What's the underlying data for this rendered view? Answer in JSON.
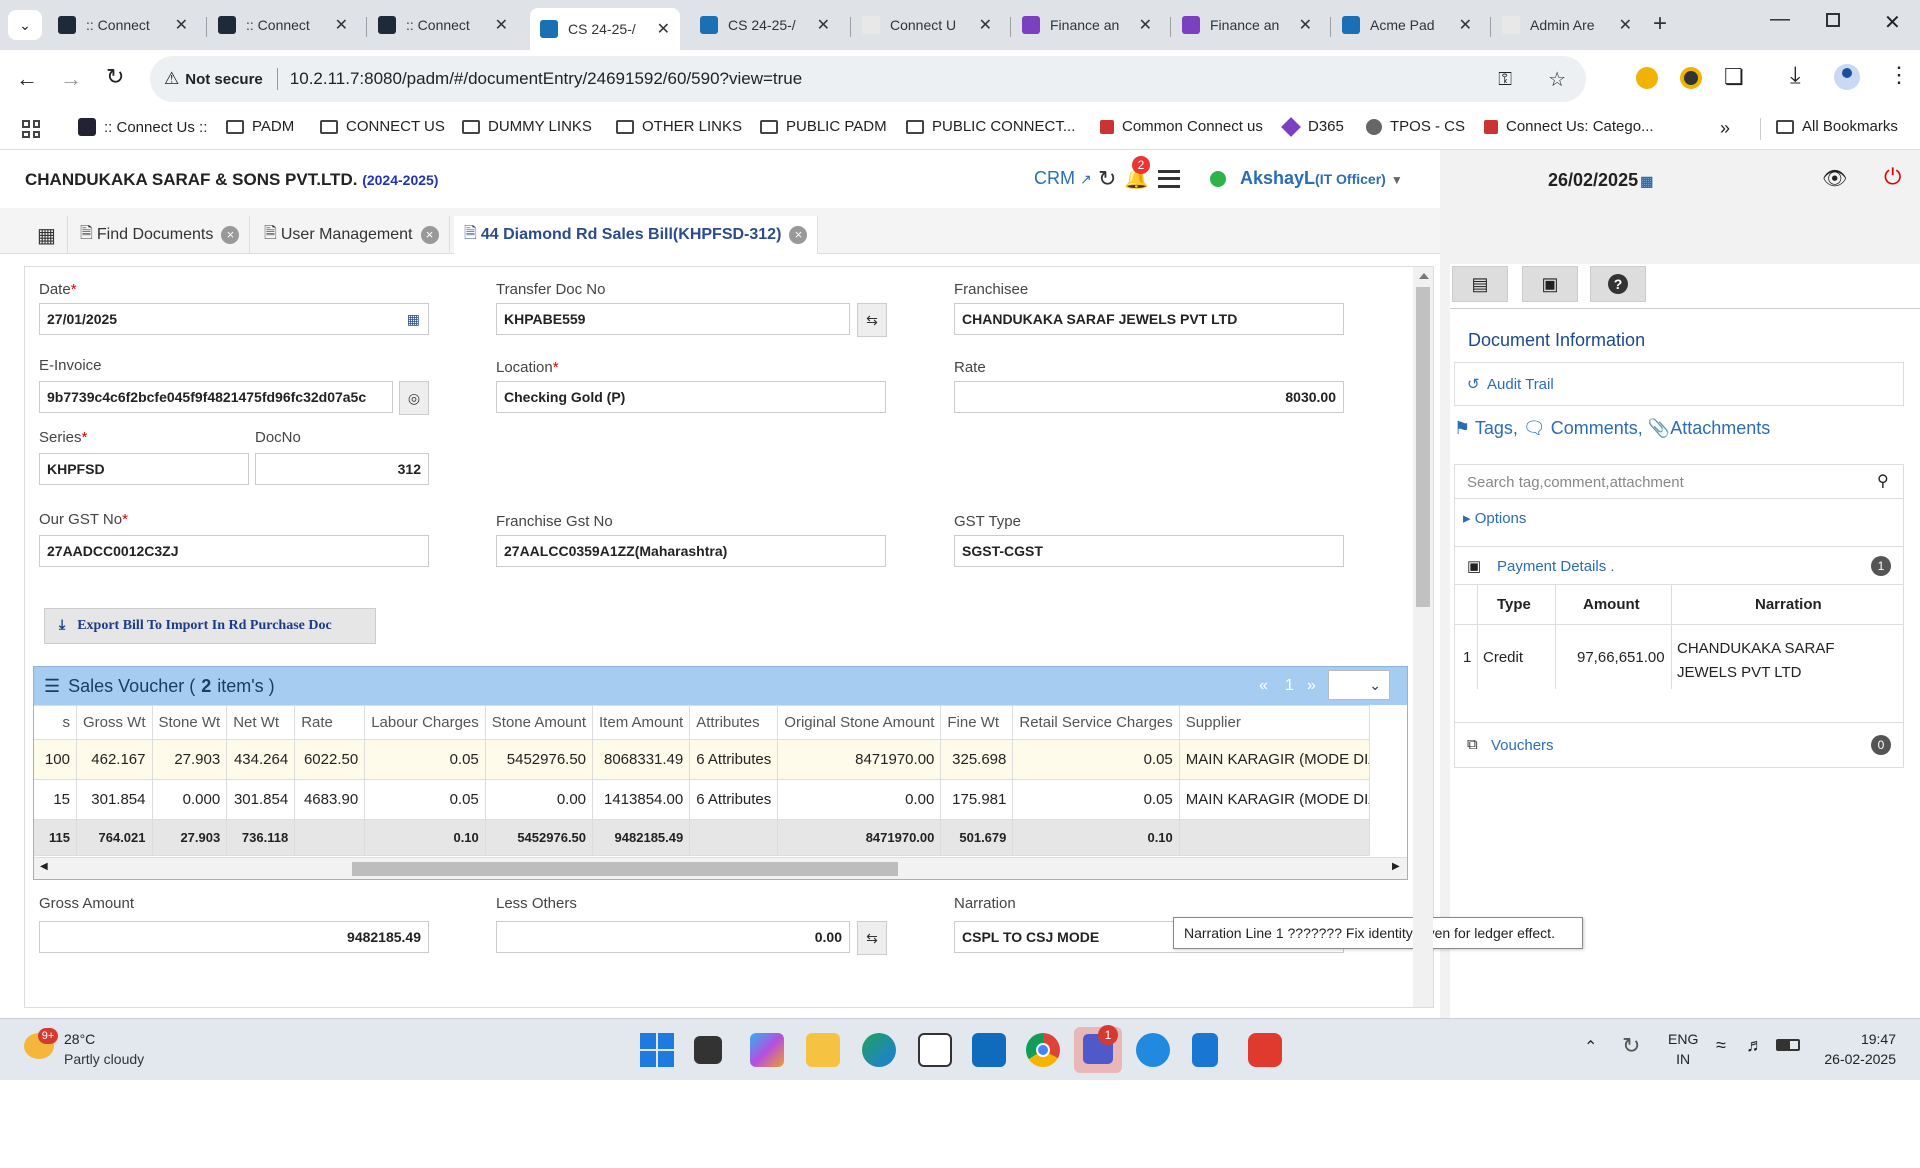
{
  "browser": {
    "tabs": [
      {
        "title": ":: Connect",
        "active": false
      },
      {
        "title": ":: Connect",
        "active": false
      },
      {
        "title": ":: Connect",
        "active": false
      },
      {
        "title": "CS 24-25-/",
        "active": true
      },
      {
        "title": "CS 24-25-/",
        "active": false
      },
      {
        "title": "Connect U",
        "active": false
      },
      {
        "title": "Finance an",
        "active": false
      },
      {
        "title": "Finance an",
        "active": false
      },
      {
        "title": "Acme Pad",
        "active": false
      },
      {
        "title": "Admin Are",
        "active": false
      }
    ],
    "security_label": "Not secure",
    "url": "10.2.11.7:8080/padm/#/documentEntry/24691592/60/590?view=true",
    "bookmarks": [
      ":: Connect Us ::",
      "PADM",
      "CONNECT US",
      "DUMMY LINKS",
      "OTHER LINKS",
      "PUBLIC PADM",
      "PUBLIC CONNECT...",
      "Common Connect us",
      "D365",
      "TPOS - CS",
      "Connect Us: Catego..."
    ],
    "all_bookmarks": "All Bookmarks",
    "more_bookmarks": "»"
  },
  "app": {
    "company": "CHANDUKAKA SARAF & SONS PVT.LTD.",
    "fy": "(2024-2025)",
    "crm": "CRM",
    "notif_count": "2",
    "user": "AkshayL",
    "role": "(IT Officer)",
    "date": "26/02/2025",
    "tabs": [
      {
        "label": "Find Documents"
      },
      {
        "label": "User Management"
      },
      {
        "label": "44 Diamond Rd Sales Bill(KHPFSD-312)"
      }
    ]
  },
  "form": {
    "date_label": "Date",
    "date_value": "27/01/2025",
    "transfer_label": "Transfer Doc No",
    "transfer_value": "KHPABE559",
    "franchisee_label": "Franchisee",
    "franchisee_value": "CHANDUKAKA SARAF JEWELS PVT LTD",
    "einvoice_label": "E-Invoice",
    "einvoice_value": "9b7739c4c6f2bcfe045f9f4821475fd96fc32d07a5c",
    "location_label": "Location",
    "location_value": "Checking Gold (P)",
    "rate_label": "Rate",
    "rate_value": "8030.00",
    "series_label": "Series",
    "series_value": "KHPFSD",
    "docno_label": "DocNo",
    "docno_value": "312",
    "gst_label": "Our GST No",
    "gst_value": "27AADCC0012C3ZJ",
    "fgst_label": "Franchise Gst No",
    "fgst_value": "27AALCC0359A1ZZ(Maharashtra)",
    "gsttype_label": "GST Type",
    "gsttype_value": "SGST-CGST",
    "export_button": "Export Bill To Import In Rd Purchase Doc",
    "gross_label": "Gross Amount",
    "gross_value": "9482185.49",
    "less_label": "Less Others",
    "less_value": "0.00",
    "narration_label": "Narration",
    "narration_value": "CSPL TO CSJ MODE",
    "tooltip": "Narration Line 1 ??????? Fix identity given for ledger effect."
  },
  "voucher": {
    "title_prefix": "Sales Voucher (",
    "count": "2",
    "title_suffix": "item's )",
    "pager_first": "«",
    "pager_page": "1",
    "pager_next": "»",
    "columns": [
      "s",
      "Gross Wt",
      "Stone Wt",
      "Net Wt",
      "Rate",
      "Labour Charges",
      "Stone Amount",
      "Item Amount",
      "Attributes",
      "Original Stone Amount",
      "Fine Wt",
      "Retail Service Charges",
      "Supplier"
    ],
    "rows": [
      [
        "100",
        "462.167",
        "27.903",
        "434.264",
        "6022.50",
        "0.05",
        "5452976.50",
        "8068331.49",
        "6 Attributes",
        "8471970.00",
        "325.698",
        "0.05",
        "MAIN KARAGIR (MODE DIA"
      ],
      [
        "15",
        "301.854",
        "0.000",
        "301.854",
        "4683.90",
        "0.05",
        "0.00",
        "1413854.00",
        "6 Attributes",
        "0.00",
        "175.981",
        "0.05",
        "MAIN KARAGIR (MODE DIA"
      ]
    ],
    "totals": [
      "115",
      "764.021",
      "27.903",
      "736.118",
      "",
      "0.10",
      "5452976.50",
      "9482185.49",
      "",
      "8471970.00",
      "501.679",
      "0.10",
      ""
    ]
  },
  "side": {
    "doc_info": "Document Information",
    "audit": "Audit Trail",
    "tags": "Tags,",
    "comments": "Comments,",
    "attachments": "Attachments",
    "search_placeholder": "Search tag,comment,attachment",
    "options": "Options",
    "payment_title": "Payment Details .",
    "payment_count": "1",
    "pay_cols": [
      "Type",
      "Amount",
      "Narration"
    ],
    "pay_row": {
      "idx": "1",
      "type": "Credit",
      "amount": "97,66,651.00",
      "narration": "CHANDUKAKA SARAF JEWELS PVT LTD"
    },
    "vouchers": "Vouchers",
    "vouchers_count": "0"
  },
  "taskbar": {
    "weather_badge": "9+",
    "temp": "28°C",
    "weather": "Partly cloudy",
    "lang1": "ENG",
    "lang2": "IN",
    "time": "19:47",
    "date": "26-02-2025",
    "teams_badge": "1"
  },
  "colors": {
    "accent": "#2a4b8d",
    "grid_header": "#a6cdf1",
    "required": "#dd0000",
    "online": "#2db34a"
  }
}
